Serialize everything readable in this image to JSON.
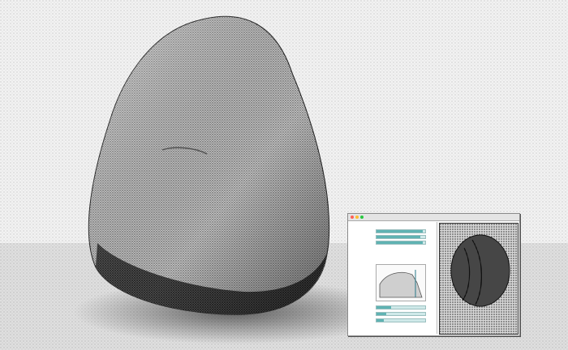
{
  "window": {
    "title": "",
    "traffic_lights": {
      "close_color": "#ff5f57",
      "minimize_color": "#febc2e",
      "zoom_color": "#28c840"
    }
  },
  "controls": {
    "sliders": [
      {
        "name": "slider-1",
        "level": 0.95
      },
      {
        "name": "slider-2",
        "level": 0.9
      },
      {
        "name": "slider-3",
        "level": 0.95
      },
      {
        "name": "slider-4",
        "level": 0.3
      },
      {
        "name": "slider-5",
        "level": 0.2
      },
      {
        "name": "slider-6",
        "level": 0.15
      }
    ],
    "accent_color": "#5fb3b3"
  },
  "preview": {
    "icon": "image-preview-icon"
  },
  "background": {
    "subject": "dithered-stone"
  }
}
